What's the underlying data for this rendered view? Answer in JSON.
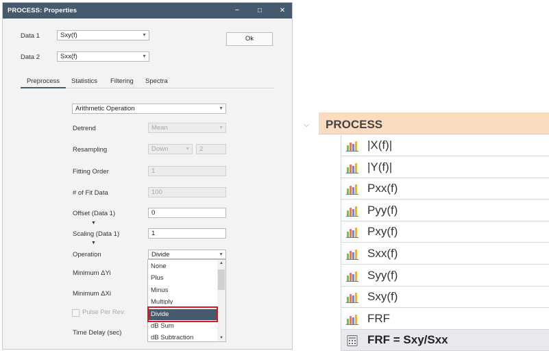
{
  "dialog": {
    "title": "PROCESS: Properties",
    "minimize": "−",
    "maximize": "□",
    "close": "✕",
    "data1_label": "Data 1",
    "data1_value": "Sxy(f)",
    "data2_label": "Data 2",
    "data2_value": "Sxx(f)",
    "ok_label": "Ok",
    "tabs": [
      "Preprocess",
      "Statistics",
      "Filtering",
      "Spectra"
    ],
    "preprocess": {
      "operation_type": "Arithmetic Operation",
      "detrend_label": "Detrend",
      "detrend_value": "Mean",
      "resampling_label": "Resampling",
      "resampling_value": "Down",
      "resampling_factor": "2",
      "fitting_order_label": "Fitting Order",
      "fitting_order_value": "1",
      "fit_data_label": "# of Fit Data",
      "fit_data_value": "100",
      "offset_label": "Offset (Data 1)",
      "offset_value": "0",
      "scaling_label": "Scaling (Data 1)",
      "scaling_value": "1",
      "operation_label": "Operation",
      "operation_value": "Divide",
      "min_dyi_label": "Minimum ΔYi",
      "min_dxi_label": "Minimum ΔXi",
      "pulse_label": "Pulse Per Rev.",
      "time_delay_label": "Time Delay (sec)"
    },
    "operation_options": [
      "None",
      "Plus",
      "Minus",
      "Multiply",
      "Divide",
      "dB Sum",
      "dB Subtraction"
    ],
    "operation_selected": "Divide"
  },
  "tree": {
    "group": "PROCESS",
    "items": [
      "|X(f)|",
      "|Y(f)|",
      "Pxx(f)",
      "Pyy(f)",
      "Pxy(f)",
      "Sxx(f)",
      "Syy(f)",
      "Sxy(f)",
      "FRF"
    ],
    "formula": "FRF = Sxy/Sxx",
    "item_icon": "bar-chart-icon",
    "formula_icon": "calculator-icon"
  },
  "colors": {
    "titlebar": "#465a6d",
    "group_header": "#fcdcbe",
    "highlight_border": "#e0141e"
  }
}
